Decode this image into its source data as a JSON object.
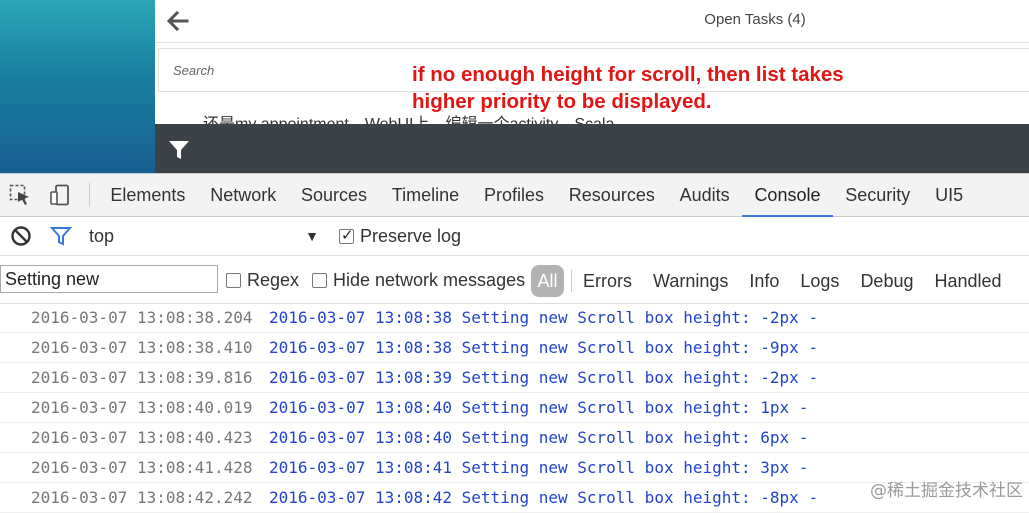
{
  "app": {
    "title": "Open Tasks (4)",
    "search_placeholder": "Search",
    "annotation": "if no enough height for scroll, then list takes\nhigher priority to be displayed.",
    "list_item_text": "还是my appointment，WebUI上，编辑一个activity，Scala"
  },
  "devtools": {
    "tabs": [
      "Elements",
      "Network",
      "Sources",
      "Timeline",
      "Profiles",
      "Resources",
      "Audits",
      "Console",
      "Security",
      "UI5"
    ],
    "active_tab": "Console",
    "toolbar": {
      "context": "top",
      "preserve_log_label": "Preserve log",
      "preserve_log_checked": true
    },
    "filter": {
      "value": "Setting new",
      "regex_label": "Regex",
      "hide_network_label": "Hide network messages",
      "all_label": "All",
      "levels": [
        "Errors",
        "Warnings",
        "Info",
        "Logs",
        "Debug",
        "Handled"
      ]
    },
    "logs": [
      {
        "ts": "2016-03-07 13:08:38.204",
        "msg": "2016-03-07 13:08:38 Setting new Scroll box height: -2px -"
      },
      {
        "ts": "2016-03-07 13:08:38.410",
        "msg": "2016-03-07 13:08:38 Setting new Scroll box height: -9px -"
      },
      {
        "ts": "2016-03-07 13:08:39.816",
        "msg": "2016-03-07 13:08:39 Setting new Scroll box height: -2px -"
      },
      {
        "ts": "2016-03-07 13:08:40.019",
        "msg": "2016-03-07 13:08:40 Setting new Scroll box height: 1px -"
      },
      {
        "ts": "2016-03-07 13:08:40.423",
        "msg": "2016-03-07 13:08:40 Setting new Scroll box height: 6px -"
      },
      {
        "ts": "2016-03-07 13:08:41.428",
        "msg": "2016-03-07 13:08:41 Setting new Scroll box height: 3px -"
      },
      {
        "ts": "2016-03-07 13:08:42.242",
        "msg": "2016-03-07 13:08:42 Setting new Scroll box height: -8px -"
      }
    ]
  },
  "watermark": "@稀土掘金技术社区",
  "colors": {
    "annotation": "#e21414",
    "log_message": "#2244cc",
    "log_timestamp": "#777777",
    "active_tab_underline": "#3879d9",
    "footer_bar": "#3c4247"
  },
  "icons": [
    "back-arrow-icon",
    "filter-funnel-icon",
    "inspect-element-icon",
    "device-mode-icon",
    "clear-console-icon",
    "console-filter-icon",
    "dropdown-arrow-icon",
    "checkbox-icon"
  ]
}
